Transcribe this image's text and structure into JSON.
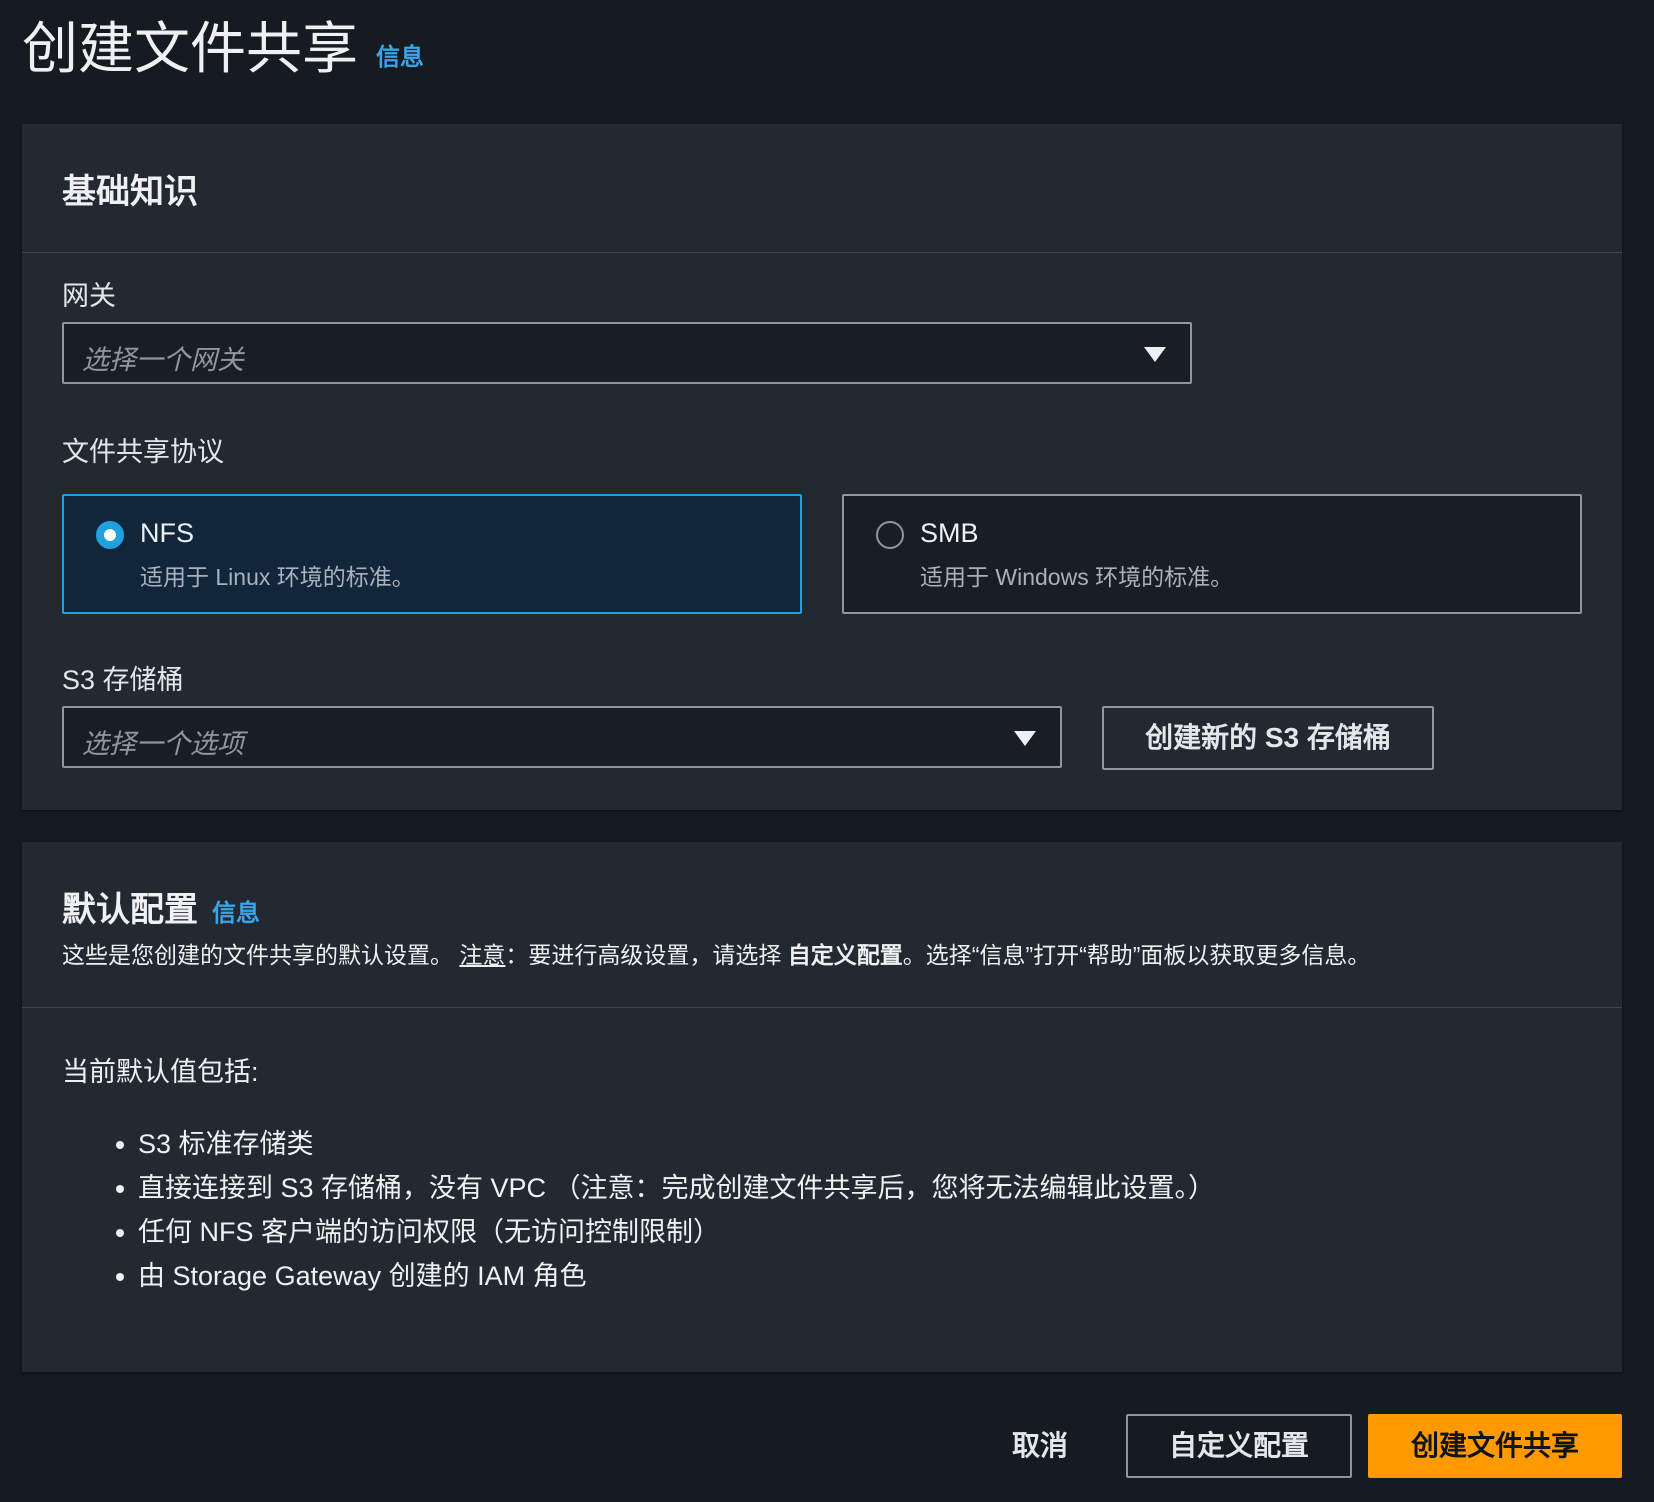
{
  "page": {
    "title": "创建文件共享",
    "info_link": "信息"
  },
  "basics": {
    "title": "基础知识",
    "gateway": {
      "label": "网关",
      "placeholder": "选择一个网关"
    },
    "protocol": {
      "label": "文件共享协议",
      "options": [
        {
          "name": "NFS",
          "description": "适用于 Linux 环境的标准。",
          "selected": true
        },
        {
          "name": "SMB",
          "description": "适用于 Windows 环境的标准。",
          "selected": false
        }
      ]
    },
    "bucket": {
      "label": "S3 存储桶",
      "placeholder": "选择一个选项",
      "create_button": "创建新的 S3 存储桶"
    }
  },
  "defaults": {
    "title": "默认配置",
    "info_link": "信息",
    "description_start": "这些是您创建的文件共享的默认设置。",
    "note_label": "注意",
    "description_mid": "：要进行高级设置，请选择",
    "description_bold": "自定义配置",
    "description_end": "。选择“信息”打开“帮助”面板以获取更多信息。",
    "intro": "当前默认值包括:",
    "items": [
      "S3 标准存储类",
      "直接连接到 S3 存储桶，没有 VPC （注意：完成创建文件共享后，您将无法编辑此设置。）",
      "任何 NFS 客户端的访问权限（无访问控制限制）",
      "由 Storage Gateway 创建的 IAM 角色"
    ]
  },
  "footer": {
    "cancel": "取消",
    "customize": "自定义配置",
    "create": "创建文件共享"
  },
  "colors": {
    "accent": "#1fa1e0",
    "primary_button": "#ff9900",
    "info_link": "#3aa4e8"
  }
}
